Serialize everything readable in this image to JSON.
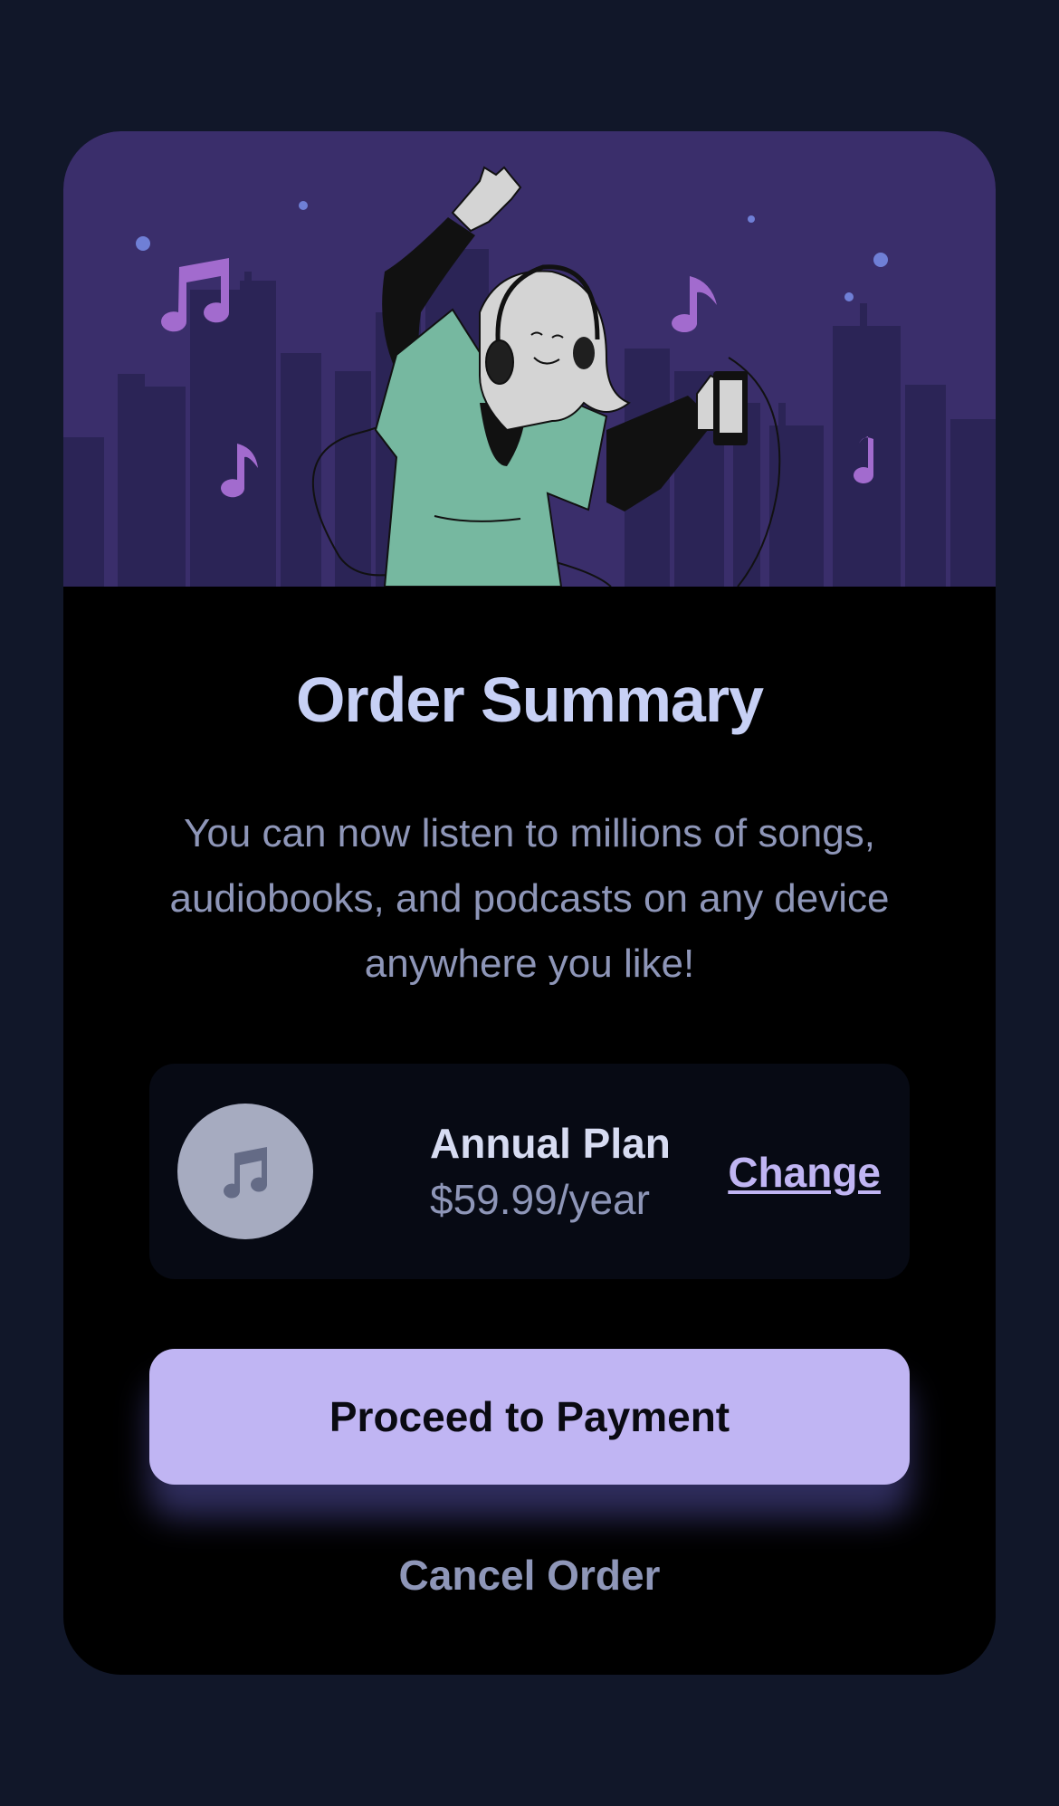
{
  "hero": {
    "illustration": "woman-dancing-with-headphones-illustration",
    "colors": {
      "sky": "#3a2e6b",
      "buildings": "#2b2456",
      "shirt": "#76b8a0",
      "notes": "#a26bce",
      "dots": "#6f7fd6"
    }
  },
  "summary": {
    "title": "Order Summary",
    "description": "You can now listen to millions of songs, audiobooks, and podcasts on any device anywhere you like!"
  },
  "plan": {
    "icon": "music-note-icon",
    "name": "Annual Plan",
    "price": "$59.99/year",
    "change_label": "Change"
  },
  "actions": {
    "proceed_label": "Proceed to Payment",
    "cancel_label": "Cancel Order"
  },
  "colors": {
    "page_background": "#111729",
    "card_background": "#000000",
    "accent": "#c0b5f3",
    "title": "#c7d0f5",
    "muted_text": "#8e96b8"
  }
}
